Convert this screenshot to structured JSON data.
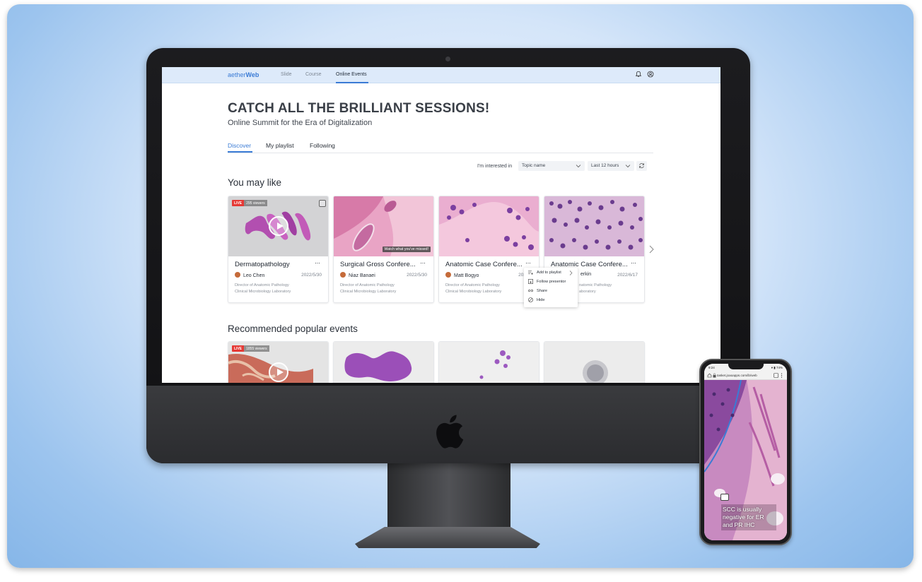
{
  "app": {
    "brand_part1": "aether",
    "brand_part2": "Web",
    "nav": [
      "Slide",
      "Course",
      "Online Events"
    ],
    "active_nav": "Online Events",
    "icons": [
      "bell-icon",
      "user-circle-icon"
    ]
  },
  "hero": {
    "title": "CATCH ALL THE BRILLIANT SESSIONS!",
    "subtitle": "Online Summit for the Era of Digitalization"
  },
  "tabs": [
    "Discover",
    "My playlist",
    "Following"
  ],
  "filters": {
    "label": "I'm interested in",
    "topic": "Topic name",
    "time": "Last 12 hours"
  },
  "sections": {
    "you_may_like": "You may like",
    "recommended": "Recommended popular events"
  },
  "cards": [
    {
      "title": "Dermatopathology",
      "presenter": "Leo Chen",
      "date": "2022/5/30",
      "meta1": "Director of Anatomic Pathology",
      "meta2": "Clinical Microbiology Laboratory",
      "live": "LIVE",
      "viewers": "295 viewers",
      "more": "···"
    },
    {
      "title": "Surgical Gross Confere...",
      "presenter": "Niaz Banaei",
      "date": "2022/5/30",
      "meta1": "Director of Anatomic Pathology",
      "meta2": "Clinical Microbiology Laboratory",
      "watch_tag": "Watch what you've missed!",
      "more": "···"
    },
    {
      "title": "Anatomic Case Confere...",
      "presenter": "Matt Bogyo",
      "date": "2022/6",
      "meta1": "Director of Anatomic Pathology",
      "meta2": "Clinical Microbiology Laboratory",
      "more": "···"
    },
    {
      "title": "Anatomic Case Confere...",
      "presenter": "erkin",
      "date": "2022/6/17",
      "meta1": "natomic Pathology",
      "meta2": "aboratory",
      "more": "···"
    }
  ],
  "popular": [
    {
      "live": "LIVE",
      "viewers": "1855 viewers"
    }
  ],
  "menu": {
    "items": [
      "Add to playlist",
      "Follow presentor",
      "Share",
      "Hide"
    ],
    "icons": [
      "playlist-add-icon",
      "follow-icon",
      "link-icon",
      "hide-icon"
    ]
  },
  "phone": {
    "time": "9:24",
    "status": "▾ ▮ 74%",
    "url": "tasket.joaoapps.com/ib/web",
    "annotation": "SCC is usually negative for ER and PR IHC"
  },
  "colors": {
    "accent": "#3a7bd5",
    "live": "#e53935",
    "nav_bg": "#ddeafa"
  }
}
